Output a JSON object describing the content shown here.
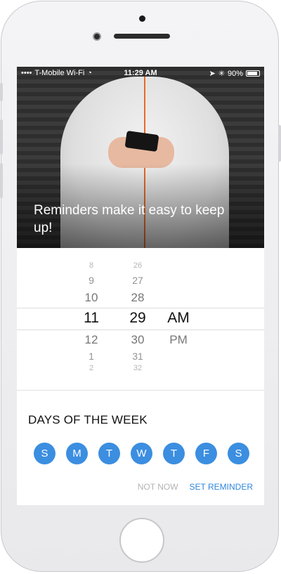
{
  "status_bar": {
    "carrier": "T-Mobile Wi-Fi",
    "time": "11:29 AM",
    "battery": "90%"
  },
  "hero": {
    "title": "Reminders make it easy to keep up!"
  },
  "picker": {
    "hours": [
      "8",
      "9",
      "10",
      "11",
      "12",
      "1",
      "2"
    ],
    "minutes": [
      "26",
      "27",
      "28",
      "29",
      "30",
      "31",
      "32"
    ],
    "periods": [
      "AM",
      "PM"
    ],
    "selected": {
      "hour": "11",
      "minute": "29",
      "period": "AM"
    }
  },
  "days_section": {
    "title": "DAYS OF THE WEEK",
    "days": [
      "S",
      "M",
      "T",
      "W",
      "T",
      "F",
      "S"
    ]
  },
  "actions": {
    "not_now": "NOT NOW",
    "set_reminder": "SET REMINDER"
  },
  "colors": {
    "accent": "#3b8ee0",
    "muted": "#b3b3b3"
  }
}
